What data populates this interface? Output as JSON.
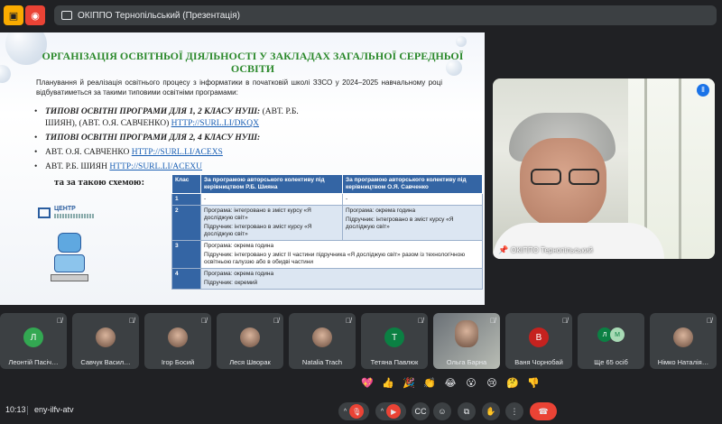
{
  "window": {
    "title": "ОКІППО Тернопільський (Презентація)"
  },
  "slide": {
    "title": "ОРГАНІЗАЦІЯ ОСВІТНЬОЇ ДІЯЛЬНОСТІ У ЗАКЛАДАХ ЗАГАЛЬНОЇ СЕРЕДНЬОЇ ОСВІТИ",
    "paragraph": "Планування й реалізація освітнього процесу з інформатики в початковій школі ЗЗСО у 2024–2025 навчальному році відбуватиметься за такими типовими освітніми програмами:",
    "bullets": [
      {
        "bold": "ТИПОВІ ОСВІТНІ ПРОГРАМИ ДЛЯ 1, 2 КЛАСУ НУШ:",
        "text": " (АВТ. Р.Б. ШИЯН), (АВТ. О.Я. САВЧЕНКО) ",
        "link": "HTTP://SURL.LI/DKQX"
      },
      {
        "bold": "ТИПОВІ ОСВІТНІ ПРОГРАМИ ДЛЯ 2, 4 КЛАСУ НУШ:",
        "text": "",
        "link": ""
      },
      {
        "bold": "",
        "text": "АВТ. О.Я. САВЧЕНКО ",
        "link": "HTTP://SURL.LI/ACEXS"
      },
      {
        "bold": "",
        "text": "АВТ. Р.Б. ШИЯН ",
        "link": "HTTP://SURL.LI/ACEXU"
      }
    ],
    "scheme_label": "та за такою схемою:",
    "logo_text": "ЦЕНТР",
    "table": {
      "headers": [
        "Клас",
        "За програмою авторського колективу під керівництвом Р.Б. Шияна",
        "За програмою авторського колективу під керівництвом О.Я. Савченко"
      ],
      "rows": [
        {
          "num": "1",
          "c1": [
            "-"
          ],
          "c2": [
            "-"
          ]
        },
        {
          "num": "2",
          "c1": [
            "Програма: інтегровано в зміст курсу «Я досліджую світ»",
            "Підручник: інтегровано в зміст курсу «Я досліджую світ»"
          ],
          "c2": [
            "Програма: окрема година",
            "Підручник: інтегровано в зміст курсу «Я досліджую світ»"
          ]
        },
        {
          "num": "3",
          "span": [
            "Програма: окрема година",
            "Підручник: інтегровано у зміст ІІ частини підручника «Я досліджую світ» разом із технологічною освітньою галуззю або в обидві частини"
          ]
        },
        {
          "num": "4",
          "span": [
            "Програма: окрема година",
            "Підручник: окремий"
          ]
        }
      ]
    }
  },
  "presenter": {
    "name": "ОКІППО Тернопільський"
  },
  "participants": [
    {
      "name": "Леонтій Пасіч…",
      "initial": "Л",
      "color": "#33a852",
      "photo": false
    },
    {
      "name": "Савчук Васил…",
      "initial": "",
      "color": "",
      "photo": true
    },
    {
      "name": "Ігор Босий",
      "initial": "",
      "color": "",
      "photo": true
    },
    {
      "name": "Леся Шворак",
      "initial": "",
      "color": "",
      "photo": true
    },
    {
      "name": "Natalia Trach",
      "initial": "",
      "color": "",
      "photo": true
    },
    {
      "name": "Тетяна Павлюк",
      "initial": "Т",
      "color": "#0b8043",
      "photo": false
    },
    {
      "name": "Ольга Барна",
      "initial": "",
      "color": "",
      "photo": true
    },
    {
      "name": "Ваня Чорнобай",
      "initial": "В",
      "color": "#c5221f",
      "photo": false
    },
    {
      "name": "Ще 65 осіб",
      "initial": "",
      "color": "",
      "photo": false
    },
    {
      "name": "Німко Наталія…",
      "initial": "",
      "color": "",
      "photo": true
    }
  ],
  "more_avatars": [
    "Л",
    "М"
  ],
  "reactions": [
    "💖",
    "👍",
    "🎉",
    "👏",
    "😂",
    "😮",
    "😢",
    "🤔",
    "👎"
  ],
  "bottom": {
    "time": "10:13",
    "meeting_code": "eny-ilfv-atv"
  }
}
